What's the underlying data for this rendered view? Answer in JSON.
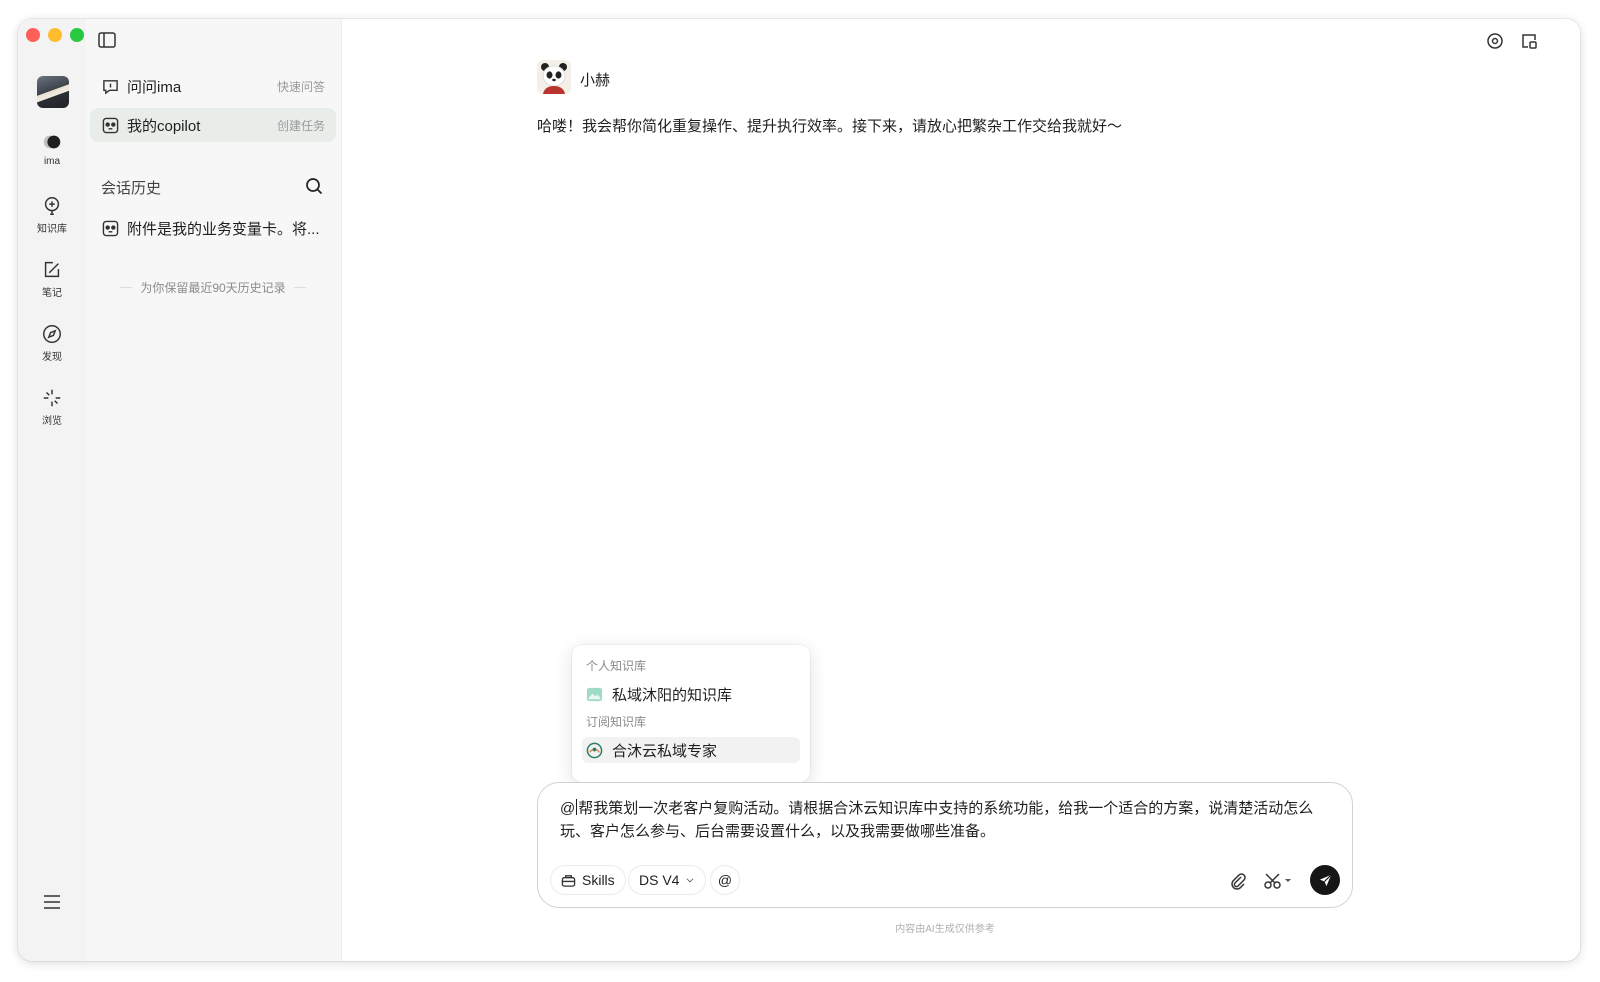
{
  "window": {
    "traffic_lights": {
      "close": "#fe5f57",
      "minimize": "#febc2e",
      "maximize": "#28c840"
    }
  },
  "rail": {
    "items": [
      {
        "label": "ima",
        "icon": "ima-logo-icon"
      },
      {
        "label": "知识库",
        "icon": "knowledge-base-icon"
      },
      {
        "label": "笔记",
        "icon": "note-icon"
      },
      {
        "label": "发现",
        "icon": "compass-icon"
      },
      {
        "label": "浏览",
        "icon": "browse-icon"
      }
    ]
  },
  "sidebar": {
    "nav": [
      {
        "label": "问问ima",
        "hint": "快速问答",
        "icon": "chat-bubble-icon"
      },
      {
        "label": "我的copilot",
        "hint": "创建任务",
        "icon": "panda-icon",
        "active": true
      }
    ],
    "history_title": "会话历史",
    "history": [
      {
        "title": "附件是我的业务变量卡。将..."
      }
    ],
    "retention_note": "为你保留最近90天历史记录"
  },
  "main": {
    "bot": {
      "name": "小赫",
      "greeting": "哈喽！我会帮你简化重复操作、提升执行效率。接下来，请放心把繁杂工作交给我就好～"
    },
    "mention_popup": {
      "groups": [
        {
          "title": "个人知识库",
          "items": [
            {
              "label": "私域沐阳的知识库",
              "icon": "folder-icon"
            }
          ]
        },
        {
          "title": "订阅知识库",
          "items": [
            {
              "label": "合沐云私域专家",
              "icon": "expert-logo-icon"
            }
          ]
        }
      ]
    },
    "composer": {
      "prefix": "@",
      "text": "帮我策划一次老客户复购活动。请根据合沐云知识库中支持的系统功能，给我一个适合的方案，说清楚活动怎么玩、客户怎么参与、后台需要设置什么，以及我需要做哪些准备。",
      "skills_label": "Skills",
      "model_label": "DS V4",
      "at_label": "@"
    },
    "disclaimer": "内容由AI生成仅供参考"
  }
}
